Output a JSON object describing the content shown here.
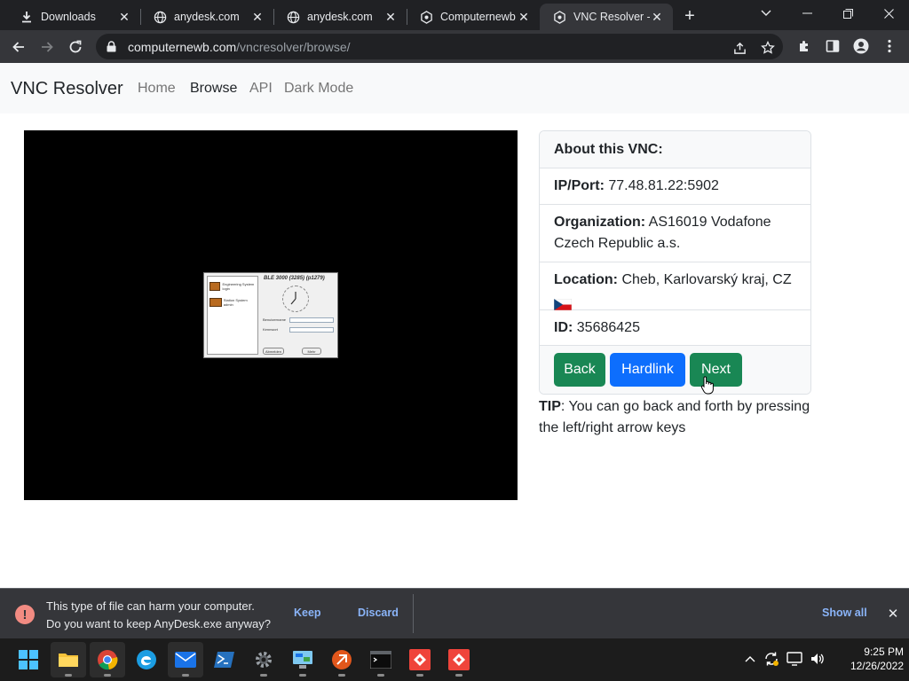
{
  "browser": {
    "tabs": [
      {
        "title": "Downloads",
        "icon": "download-icon",
        "active": false
      },
      {
        "title": "anydesk.com",
        "icon": "globe-icon",
        "active": false
      },
      {
        "title": "anydesk.com",
        "icon": "globe-icon",
        "active": false
      },
      {
        "title": "Computernewb",
        "icon": "computernewb-icon",
        "active": false
      },
      {
        "title": "VNC Resolver -",
        "icon": "computernewb-icon",
        "active": true
      }
    ],
    "url_host": "computernewb.com",
    "url_path": "/vncresolver/browse/"
  },
  "site": {
    "brand": "VNC Resolver",
    "nav": [
      "Home",
      "Browse",
      "API",
      "Dark Mode"
    ],
    "nav_active": "Browse"
  },
  "vnc_preview": {
    "window_title": "BLE 3000 (3285) (p1279)",
    "side_items": [
      "Engineering System login",
      "Station System admin"
    ],
    "fields": [
      "Benutzername",
      "Kennwort"
    ],
    "buttons": [
      "Abmelden",
      "Mehr"
    ]
  },
  "about": {
    "header": "About this VNC:",
    "ip_label": "IP/Port:",
    "ip_value": "77.48.81.22:5902",
    "org_label": "Organization:",
    "org_value": "AS16019 Vodafone Czech Republic a.s.",
    "location_label": "Location:",
    "location_value": "Cheb, Karlovarský kraj, CZ",
    "location_flag": "czech-flag-icon",
    "id_label": "ID:",
    "id_value": "35686425",
    "buttons": {
      "back": "Back",
      "hardlink": "Hardlink",
      "next": "Next"
    }
  },
  "tip": {
    "label": "TIP",
    "text": ": You can go back and forth by pressing the left/right arrow keys"
  },
  "download_bar": {
    "line1": "This type of file can harm your computer.",
    "line2": "Do you want to keep AnyDesk.exe anyway?",
    "keep": "Keep",
    "discard": "Discard",
    "show_all": "Show all"
  },
  "taskbar": {
    "time": "9:25 PM",
    "date": "12/26/2022"
  },
  "colors": {
    "success": "#198754",
    "primary": "#0d6efd",
    "chrome_dark": "#202124",
    "chrome_toolbar": "#35363a",
    "link_blue": "#8ab4f8",
    "warning_red": "#f28b82"
  }
}
